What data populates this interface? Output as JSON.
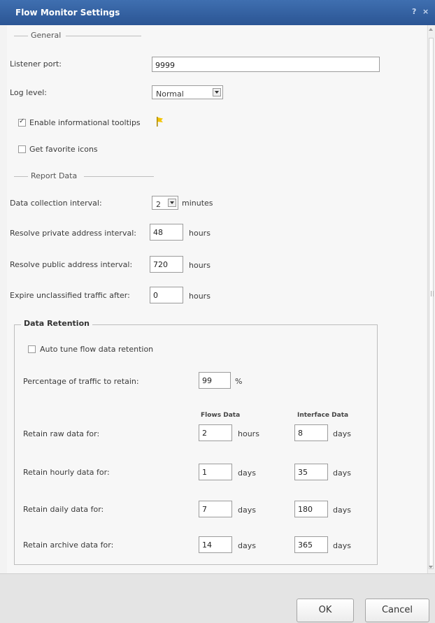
{
  "window": {
    "title": "Flow Monitor Settings",
    "help_glyph": "?",
    "close_glyph": "×"
  },
  "general": {
    "header": "General",
    "listener_port_label": "Listener port:",
    "listener_port_value": "9999",
    "log_level_label": "Log level:",
    "log_level_value": "Normal",
    "tooltips_label": "Enable informational tooltips",
    "tooltips_checked": true,
    "favicons_label": "Get favorite icons",
    "favicons_checked": false
  },
  "report": {
    "header": "Report Data",
    "interval_label": "Data collection interval:",
    "interval_value": "2",
    "interval_unit": "minutes",
    "private_label": "Resolve private address interval:",
    "private_value": "48",
    "private_unit": "hours",
    "public_label": "Resolve public address interval:",
    "public_value": "720",
    "public_unit": "hours",
    "expire_label": "Expire unclassified traffic after:",
    "expire_value": "0",
    "expire_unit": "hours"
  },
  "retention": {
    "title": "Data Retention",
    "auto_tune_label": "Auto tune flow data retention",
    "auto_tune_checked": false,
    "percent_label": "Percentage of traffic to retain:",
    "percent_value": "99",
    "percent_unit": "%",
    "flows_header": "Flows Data",
    "interface_header": "Interface Data",
    "rows": [
      {
        "label": "Retain raw data for:",
        "flows": "2",
        "flows_unit": "hours",
        "iface": "8",
        "iface_unit": "days"
      },
      {
        "label": "Retain hourly data for:",
        "flows": "1",
        "flows_unit": "days",
        "iface": "35",
        "iface_unit": "days"
      },
      {
        "label": "Retain daily data for:",
        "flows": "7",
        "flows_unit": "days",
        "iface": "180",
        "iface_unit": "days"
      },
      {
        "label": "Retain archive data for:",
        "flows": "14",
        "flows_unit": "days",
        "iface": "365",
        "iface_unit": "days"
      }
    ]
  },
  "buttons": {
    "ok": "OK",
    "cancel": "Cancel"
  }
}
